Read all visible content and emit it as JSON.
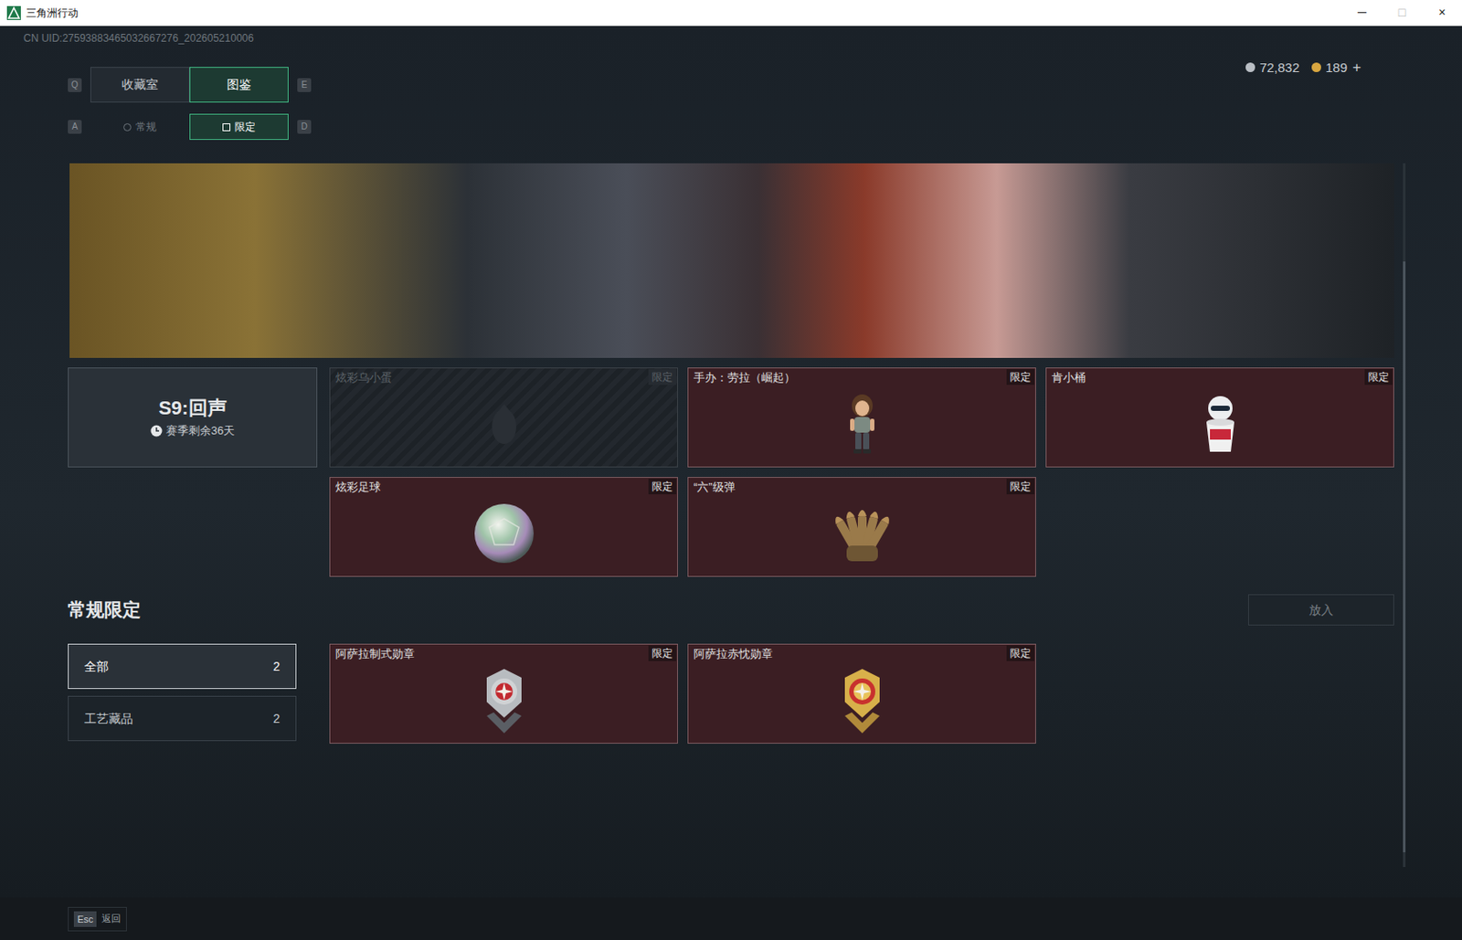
{
  "window": {
    "title": "三角洲行动",
    "controls": [
      "─",
      "□",
      "×"
    ]
  },
  "uid": "CN UID:27593883465032667276_202605210006",
  "currency": [
    {
      "amount": "72,832",
      "color": "#b9bec4"
    },
    {
      "amount": "189",
      "color": "#d8a640"
    }
  ],
  "currency_add": "+",
  "main_tabs": {
    "prev_key": "Q",
    "next_key": "E",
    "items": [
      {
        "label": "收藏室",
        "selected": false
      },
      {
        "label": "图鉴",
        "selected": true
      }
    ]
  },
  "sub_tabs": {
    "prev_key": "A",
    "next_key": "D",
    "items": [
      {
        "label": "常规",
        "selected": false
      },
      {
        "label": "限定",
        "selected": true
      }
    ]
  },
  "season": {
    "title": "S9:回声",
    "remaining": "赛季剩余36天"
  },
  "season_items": [
    {
      "name": "炫彩乌小蛋",
      "badge": "限定",
      "locked": true,
      "kind": "egg"
    },
    {
      "name": "手办：劳拉（崛起）",
      "badge": "限定",
      "locked": false,
      "kind": "figure"
    },
    {
      "name": "肯小桶",
      "badge": "限定",
      "locked": false,
      "kind": "mascot"
    },
    {
      "name": "炫彩足球",
      "badge": "限定",
      "locked": false,
      "kind": "ball"
    },
    {
      "name": "“六”级弹",
      "badge": "限定",
      "locked": false,
      "kind": "bullets"
    }
  ],
  "section": {
    "title": "常规限定",
    "filters": [
      {
        "label": "全部",
        "count": "2",
        "selected": true
      },
      {
        "label": "工艺藏品",
        "count": "2",
        "selected": false
      }
    ],
    "items": [
      {
        "name": "阿萨拉制式勋章",
        "badge": "限定",
        "locked": false,
        "kind": "medal-red"
      },
      {
        "name": "阿萨拉赤忱勋章",
        "badge": "限定",
        "locked": false,
        "kind": "medal-gold"
      }
    ]
  },
  "place_button": {
    "label": "放入",
    "disabled": true
  },
  "footer": {
    "key": "Esc",
    "label": "返回"
  }
}
